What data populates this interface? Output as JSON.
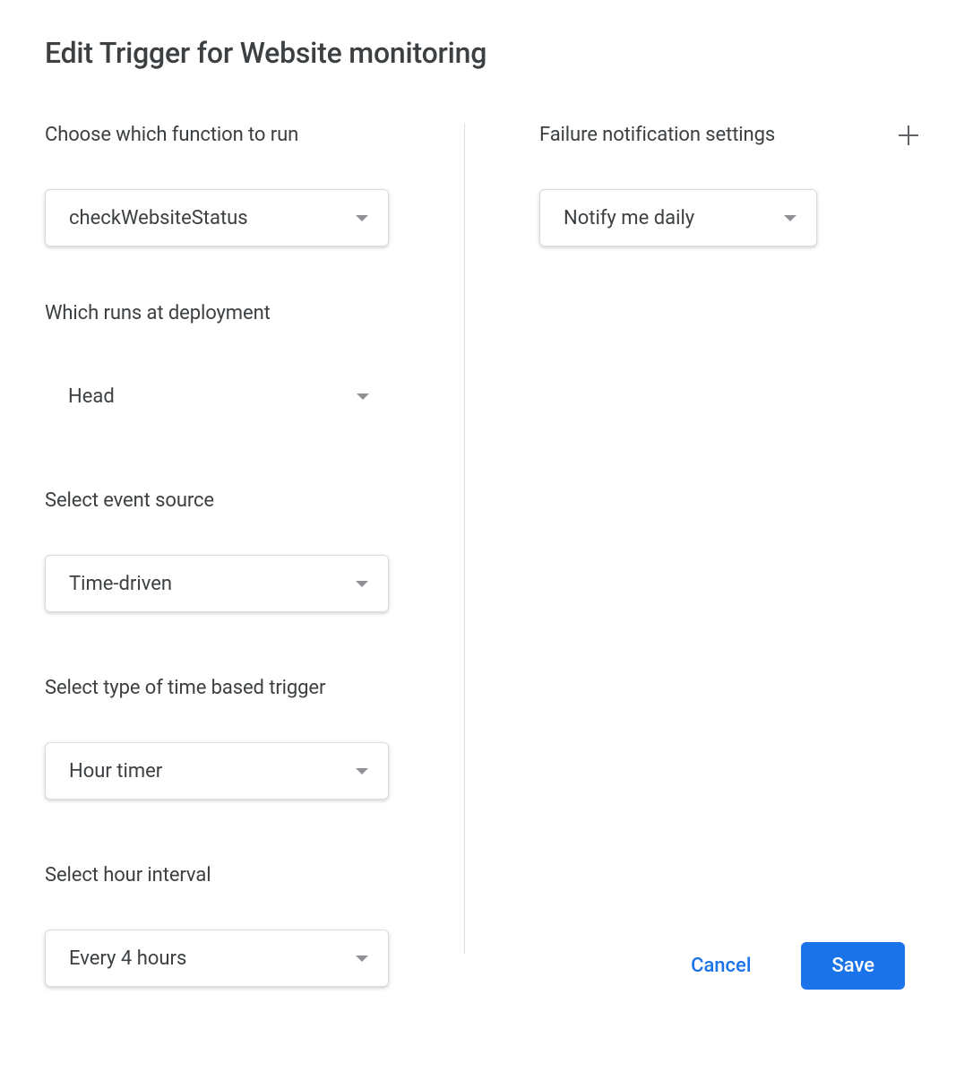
{
  "title": "Edit Trigger for Website monitoring",
  "left": {
    "function": {
      "label": "Choose which function to run",
      "value": "checkWebsiteStatus"
    },
    "deployment": {
      "label": "Which runs at deployment",
      "value": "Head"
    },
    "event_source": {
      "label": "Select event source",
      "value": "Time-driven"
    },
    "trigger_type": {
      "label": "Select type of time based trigger",
      "value": "Hour timer"
    },
    "interval": {
      "label": "Select hour interval",
      "value": "Every 4 hours"
    }
  },
  "right": {
    "label": "Failure notification settings",
    "value": "Notify me daily"
  },
  "footer": {
    "cancel": "Cancel",
    "save": "Save"
  }
}
